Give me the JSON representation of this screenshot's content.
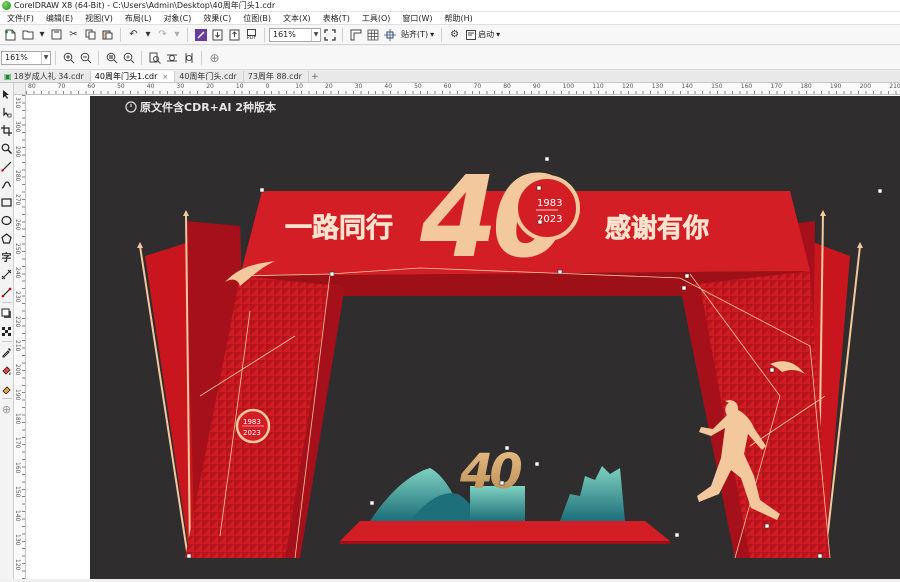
{
  "window": {
    "title": "CorelDRAW X8 (64-Bit) - C:\\Users\\Admin\\Desktop\\40周年门头1.cdr"
  },
  "menu": [
    {
      "id": "file",
      "label": "文件(F)"
    },
    {
      "id": "edit",
      "label": "编辑(E)"
    },
    {
      "id": "view",
      "label": "视图(V)"
    },
    {
      "id": "layout",
      "label": "布局(L)"
    },
    {
      "id": "object",
      "label": "对象(C)"
    },
    {
      "id": "effects",
      "label": "效果(C)"
    },
    {
      "id": "bitmaps",
      "label": "位图(B)"
    },
    {
      "id": "text",
      "label": "文本(X)"
    },
    {
      "id": "table",
      "label": "表格(T)"
    },
    {
      "id": "tools",
      "label": "工具(O)"
    },
    {
      "id": "window",
      "label": "窗口(W)"
    },
    {
      "id": "help",
      "label": "帮助(H)"
    }
  ],
  "toolbar": {
    "zoom_value": "161%",
    "snap_label": "贴齐(T)",
    "launch_label": "启动",
    "pdf_label": "PDF"
  },
  "toolbar2": {
    "zoom_value": "161%"
  },
  "tabs": [
    {
      "label": "18岁成人礼 34.cdr",
      "active": false
    },
    {
      "label": "40周年门头1.cdr",
      "active": true
    },
    {
      "label": "40周年门头.cdr",
      "active": false
    },
    {
      "label": "73周年 88.cdr",
      "active": false
    }
  ],
  "ruler": {
    "h_labels": [
      "80",
      "70",
      "60",
      "50",
      "40",
      "30",
      "20",
      "10",
      "0",
      "10",
      "20",
      "30",
      "40",
      "50",
      "60",
      "70",
      "80",
      "90",
      "100",
      "110",
      "120",
      "130",
      "140",
      "150",
      "160",
      "170",
      "180",
      "190",
      "200",
      "210"
    ],
    "v_labels": [
      "310",
      "300",
      "290",
      "280",
      "270",
      "260",
      "250",
      "240",
      "230",
      "220",
      "210",
      "200",
      "190",
      "180",
      "170",
      "160",
      "150",
      "140",
      "130",
      "120"
    ]
  },
  "artwork": {
    "note": "原文件含CDR+AI 2种版本",
    "slogan_left": "一路同行",
    "slogan_right": "感谢有你",
    "anniversary_number": "40",
    "year_start": "1983",
    "year_end": "2023",
    "colors": {
      "red": "#d41e26",
      "dark_red": "#9e1017",
      "gold": "#f2c89c",
      "background": "#2f2d2e",
      "teal": "#2b9e9a"
    }
  }
}
